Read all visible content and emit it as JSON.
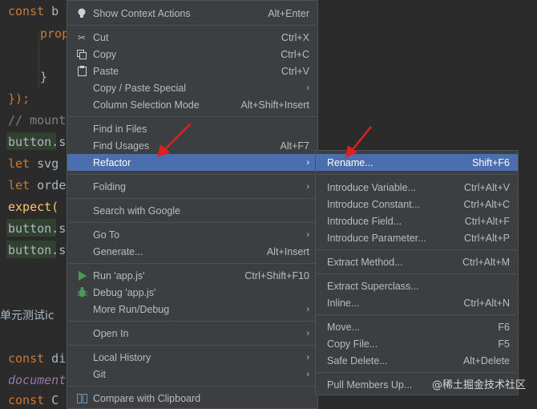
{
  "editor": {
    "lines": {
      "l1_kw": "const",
      "l1_rest": " b",
      "l2": "prop",
      "l3": "}",
      "l4": "});",
      "l5": "// mount",
      "l6": "button.s",
      "l7_kw": "let",
      "l7_rest": " svg",
      "l8_kw": "let",
      "l8_rest": " orde",
      "l9": "expect(",
      "l10": "button.s",
      "l11": "button.s",
      "l12": "单元测试ic",
      "l13_kw": "const",
      "l13_rest": " di",
      "l14": "document",
      "l15_kw": "const",
      "l15_rest": " C"
    }
  },
  "context_menu": {
    "show_context_actions": {
      "label": "Show Context Actions",
      "shortcut": "Alt+Enter"
    },
    "cut": {
      "label": "Cut",
      "shortcut": "Ctrl+X"
    },
    "copy": {
      "label": "Copy",
      "shortcut": "Ctrl+C"
    },
    "paste": {
      "label": "Paste",
      "shortcut": "Ctrl+V"
    },
    "copy_paste_special": {
      "label": "Copy / Paste Special"
    },
    "column_selection_mode": {
      "label": "Column Selection Mode",
      "shortcut": "Alt+Shift+Insert"
    },
    "find_in_files": {
      "label": "Find in Files"
    },
    "find_usages": {
      "label": "Find Usages",
      "shortcut": "Alt+F7"
    },
    "refactor": {
      "label": "Refactor"
    },
    "folding": {
      "label": "Folding"
    },
    "search_with_google": {
      "label": "Search with Google"
    },
    "go_to": {
      "label": "Go To"
    },
    "generate": {
      "label": "Generate...",
      "shortcut": "Alt+Insert"
    },
    "run_app": {
      "label": "Run 'app.js'",
      "shortcut": "Ctrl+Shift+F10"
    },
    "debug_app": {
      "label": "Debug 'app.js'"
    },
    "more_run_debug": {
      "label": "More Run/Debug"
    },
    "open_in": {
      "label": "Open In"
    },
    "local_history": {
      "label": "Local History"
    },
    "git": {
      "label": "Git"
    },
    "compare_with_clipboard": {
      "label": "Compare with Clipboard"
    }
  },
  "refactor_submenu": {
    "rename": {
      "label": "Rename...",
      "shortcut": "Shift+F6"
    },
    "introduce_variable": {
      "label": "Introduce Variable...",
      "shortcut": "Ctrl+Alt+V"
    },
    "introduce_constant": {
      "label": "Introduce Constant...",
      "shortcut": "Ctrl+Alt+C"
    },
    "introduce_field": {
      "label": "Introduce Field...",
      "shortcut": "Ctrl+Alt+F"
    },
    "introduce_parameter": {
      "label": "Introduce Parameter...",
      "shortcut": "Ctrl+Alt+P"
    },
    "extract_method": {
      "label": "Extract Method...",
      "shortcut": "Ctrl+Alt+M"
    },
    "extract_superclass": {
      "label": "Extract Superclass..."
    },
    "inline": {
      "label": "Inline...",
      "shortcut": "Ctrl+Alt+N"
    },
    "move": {
      "label": "Move...",
      "shortcut": "F6"
    },
    "copy_file": {
      "label": "Copy File...",
      "shortcut": "F5"
    },
    "safe_delete": {
      "label": "Safe Delete...",
      "shortcut": "Alt+Delete"
    },
    "pull_members_up": {
      "label": "Pull Members Up..."
    }
  },
  "watermark": "@稀土掘金技术社区",
  "colors": {
    "menu_bg": "#3c3f41",
    "selected": "#4b6eaf",
    "annotation_arrow": "#e02020"
  }
}
